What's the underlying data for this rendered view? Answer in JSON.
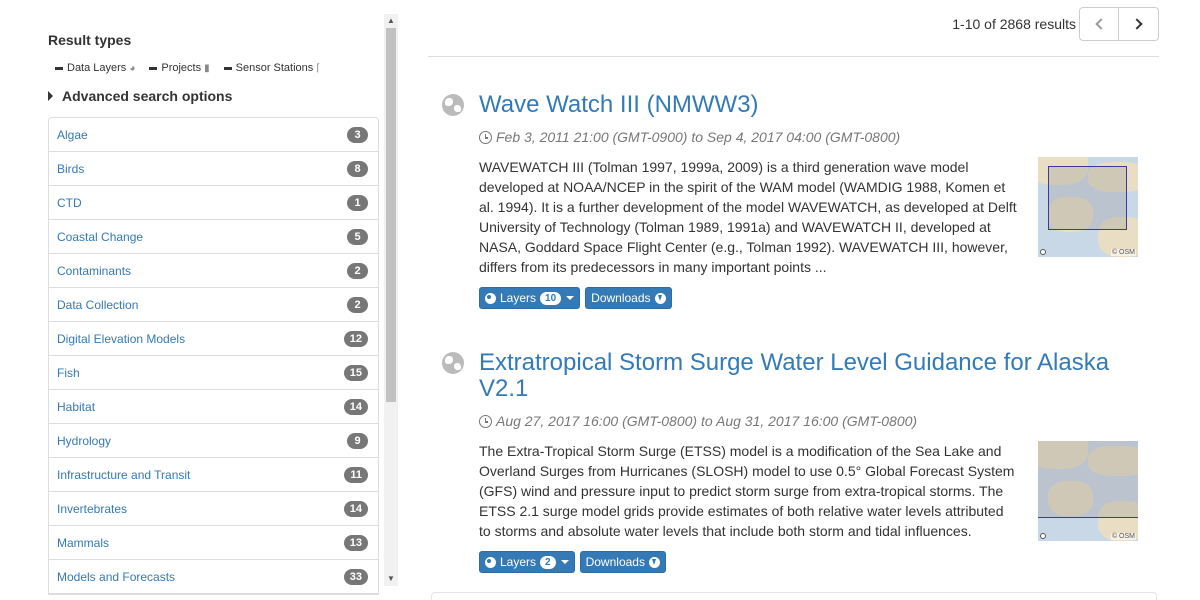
{
  "sidebar": {
    "result_types_title": "Result types",
    "legend": [
      {
        "label": "Data Layers",
        "icon": "globe-icon"
      },
      {
        "label": "Projects",
        "icon": "book-icon"
      },
      {
        "label": "Sensor Stations",
        "icon": "sensor-icon"
      }
    ],
    "advanced_search_label": "Advanced search options",
    "categories": [
      {
        "label": "Algae",
        "count": "3"
      },
      {
        "label": "Birds",
        "count": "8"
      },
      {
        "label": "CTD",
        "count": "1"
      },
      {
        "label": "Coastal Change",
        "count": "5"
      },
      {
        "label": "Contaminants",
        "count": "2"
      },
      {
        "label": "Data Collection",
        "count": "2"
      },
      {
        "label": "Digital Elevation Models",
        "count": "12"
      },
      {
        "label": "Fish",
        "count": "15"
      },
      {
        "label": "Habitat",
        "count": "14"
      },
      {
        "label": "Hydrology",
        "count": "9"
      },
      {
        "label": "Infrastructure and Transit",
        "count": "11"
      },
      {
        "label": "Invertebrates",
        "count": "14"
      },
      {
        "label": "Mammals",
        "count": "13"
      },
      {
        "label": "Models and Forecasts",
        "count": "33"
      }
    ]
  },
  "main": {
    "pager_text": "1-10 of 2868 results",
    "results": [
      {
        "title": "Wave Watch III (NMWW3)",
        "date_range": "Feb 3, 2011 21:00 (GMT-0900) to Sep 4, 2017 04:00 (GMT-0800)",
        "description": "WAVEWATCH III (Tolman 1997, 1999a, 2009) is a third generation wave model developed at NOAA/NCEP in the spirit of the WAM model (WAMDIG 1988, Komen et al. 1994). It is a further development of the model WAVEWATCH, as developed at Delft University of Technology (Tolman 1989, 1991a) and WAVEWATCH II, developed at NASA, Goddard Space Flight Center (e.g., Tolman 1992). WAVEWATCH III, however, differs from its predecessors in many important points ...",
        "layers_label": "Layers",
        "layers_count": "10",
        "downloads_label": "Downloads",
        "map_attribution": "© OSM"
      },
      {
        "title": "Extratropical Storm Surge Water Level Guidance for Alaska V2.1",
        "date_range": "Aug 27, 2017 16:00 (GMT-0800) to Aug 31, 2017 16:00 (GMT-0800)",
        "description": "The Extra-Tropical Storm Surge (ETSS) model is a modification of the Sea Lake and Overland Surges from Hurricanes (SLOSH) model to use 0.5° Global Forecast System (GFS) wind and pressure input to predict storm surge from extra-tropical storms. The ETSS 2.1 surge model grids provide estimates of both relative water levels attributed to storms and absolute water levels that include both storm and tidal influences.",
        "layers_label": "Layers",
        "layers_count": "2",
        "downloads_label": "Downloads",
        "map_attribution": "© OSM"
      }
    ]
  },
  "colors": {
    "link": "#337ab7",
    "badge": "#777777",
    "border": "#dddddd"
  }
}
